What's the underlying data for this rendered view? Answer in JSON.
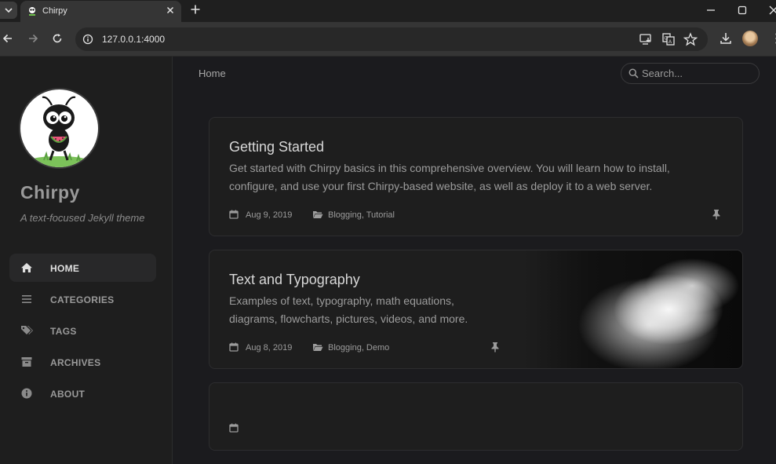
{
  "browser": {
    "tab_title": "Chirpy",
    "url": "127.0.0.1:4000"
  },
  "site": {
    "title": "Chirpy",
    "subtitle": "A text-focused Jekyll theme"
  },
  "nav": {
    "items": [
      {
        "label": "HOME",
        "icon": "home-icon",
        "active": true
      },
      {
        "label": "CATEGORIES",
        "icon": "stream-icon"
      },
      {
        "label": "TAGS",
        "icon": "tags-icon"
      },
      {
        "label": "ARCHIVES",
        "icon": "archive-icon"
      },
      {
        "label": "ABOUT",
        "icon": "info-circle-icon"
      }
    ]
  },
  "topbar": {
    "breadcrumb": "Home",
    "search_placeholder": "Search..."
  },
  "posts": [
    {
      "title": "Getting Started",
      "description": "Get started with Chirpy basics in this comprehensive overview. You will learn how to install, configure, and use your first Chirpy-based website, as well as deploy it to a web server.",
      "date": "Aug 9, 2019",
      "categories": "Blogging, Tutorial",
      "pinned": true
    },
    {
      "title": "Text and Typography",
      "description": "Examples of text, typography, math equations, diagrams, flowcharts, pictures, videos, and more.",
      "date": "Aug 8, 2019",
      "categories": "Blogging, Demo",
      "pinned": true
    },
    {
      "title": "",
      "description": "",
      "date": "",
      "categories": ""
    }
  ],
  "colors": {
    "page_bg": "#1b1b1e",
    "sidebar_bg": "#1e1e1e",
    "card_bg": "#1e1e1e",
    "active_nav_bg": "#282829"
  }
}
